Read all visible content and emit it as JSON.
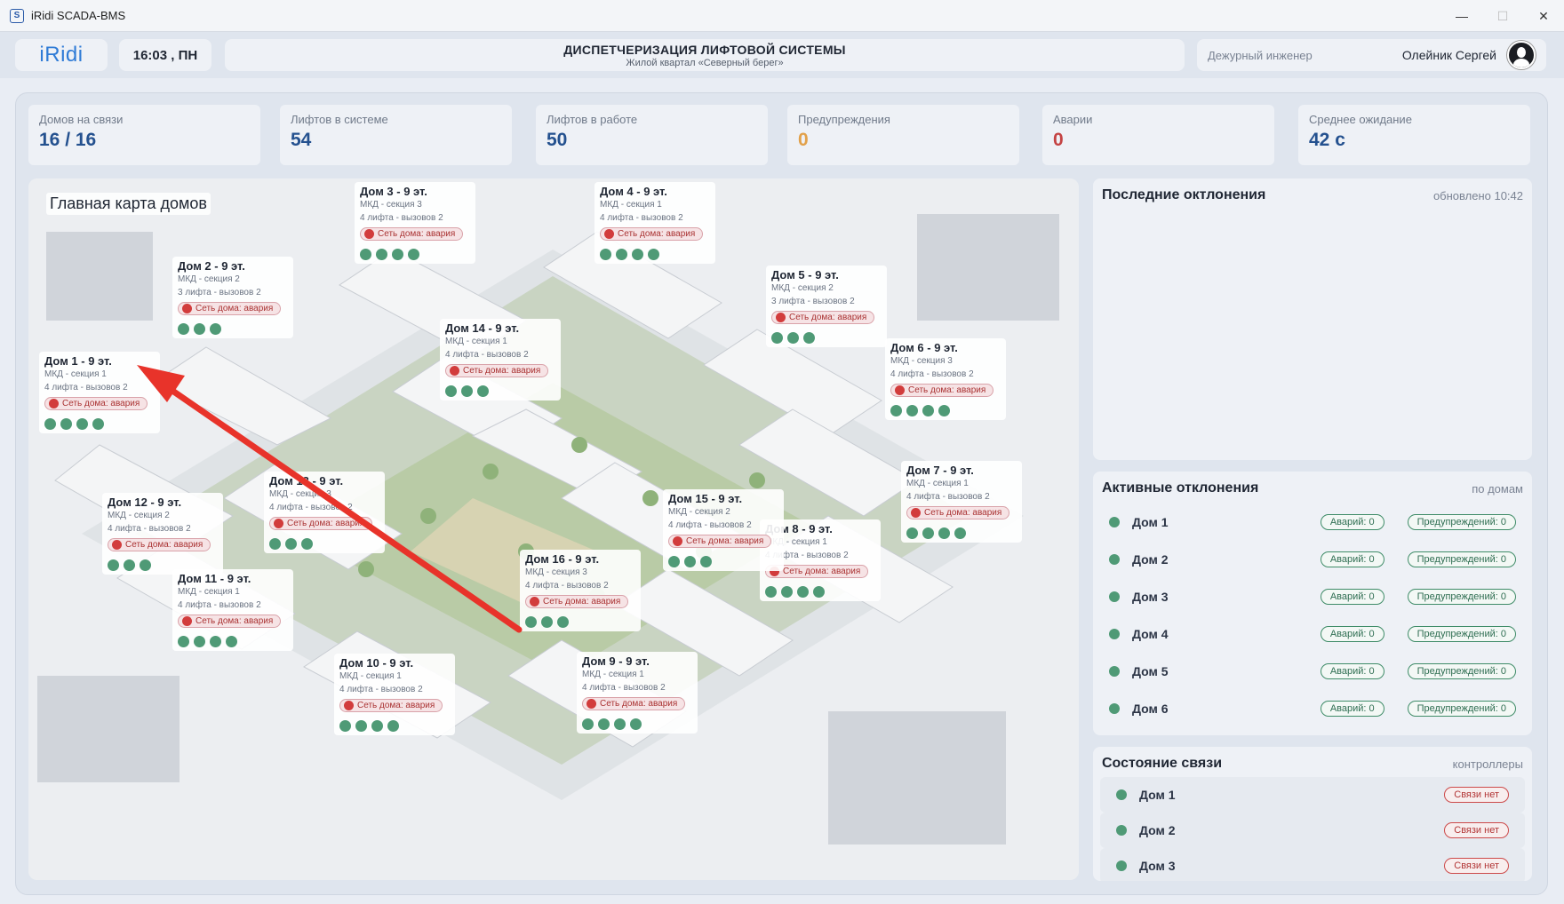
{
  "window": {
    "app_icon": "S",
    "title": "iRidi SCADA-BMS",
    "minimize": "—",
    "maximize": "☐",
    "close": "✕"
  },
  "header": {
    "logo": "iRidi",
    "time": "16:03 , ПН",
    "title": "ДИСПЕТЧЕРИЗАЦИЯ ЛИФТОВОЙ СИСТЕМЫ",
    "subtitle": "Жилой квартал «Северный берег»",
    "role": "Дежурный инженер",
    "user": "Олейник Сергей"
  },
  "kpis": [
    {
      "label": "Домов на связи",
      "value": "16 / 16"
    },
    {
      "label": "Лифтов в системе",
      "value": "54"
    },
    {
      "label": "Лифтов в работе",
      "value": "50"
    },
    {
      "label": "Предупреждения",
      "value": "0"
    },
    {
      "label": "Аварии",
      "value": "0"
    },
    {
      "label": "Среднее ожидание",
      "value": "42 с"
    }
  ],
  "map": {
    "title": "Главная карта домов",
    "houses": [
      {
        "title": "Дом 1 - 9 эт.",
        "section": "МКД - секция 1",
        "lifts": "4 лифта - вызовов 2",
        "alarm": "Сеть дома: авария",
        "dots": 4
      },
      {
        "title": "Дом 2 - 9 эт.",
        "section": "МКД - секция 2",
        "lifts": "3 лифта - вызовов 2",
        "alarm": "Сеть дома: авария",
        "dots": 3
      },
      {
        "title": "Дом 3 - 9 эт.",
        "section": "МКД - секция 3",
        "lifts": "4 лифта - вызовов 2",
        "alarm": "Сеть дома: авария",
        "dots": 4
      },
      {
        "title": "Дом 4 - 9 эт.",
        "section": "МКД - секция 1",
        "lifts": "4 лифта - вызовов 2",
        "alarm": "Сеть дома: авария",
        "dots": 4
      },
      {
        "title": "Дом 5 - 9 эт.",
        "section": "МКД - секция 2",
        "lifts": "3 лифта - вызовов 2",
        "alarm": "Сеть дома: авария",
        "dots": 3
      },
      {
        "title": "Дом 6 - 9 эт.",
        "section": "МКД - секция 3",
        "lifts": "4 лифта - вызовов 2",
        "alarm": "Сеть дома: авария",
        "dots": 4
      },
      {
        "title": "Дом 7 - 9 эт.",
        "section": "МКД - секция 1",
        "lifts": "4 лифта - вызовов 2",
        "alarm": "Сеть дома: авария",
        "dots": 4
      },
      {
        "title": "Дом 8 - 9 эт.",
        "section": "МКД - секция 1",
        "lifts": "4 лифта - вызовов 2",
        "alarm": "Сеть дома: авария",
        "dots": 4
      },
      {
        "title": "Дом 9 - 9 эт.",
        "section": "МКД - секция 1",
        "lifts": "4 лифта - вызовов 2",
        "alarm": "Сеть дома: авария",
        "dots": 4
      },
      {
        "title": "Дом 10 - 9 эт.",
        "section": "МКД - секция 1",
        "lifts": "4 лифта - вызовов 2",
        "alarm": "Сеть дома: авария",
        "dots": 4
      },
      {
        "title": "Дом 11 - 9 эт.",
        "section": "МКД - секция 1",
        "lifts": "4 лифта - вызовов 2",
        "alarm": "Сеть дома: авария",
        "dots": 4
      },
      {
        "title": "Дом 12 - 9 эт.",
        "section": "МКД - секция 2",
        "lifts": "4 лифта - вызовов 2",
        "alarm": "Сеть дома: авария",
        "dots": 3
      },
      {
        "title": "Дом 13 - 9 эт.",
        "section": "МКД - секция 3",
        "lifts": "4 лифта - вызовов 2",
        "alarm": "Сеть дома: авария",
        "dots": 3
      },
      {
        "title": "Дом 14 - 9 эт.",
        "section": "МКД - секция 1",
        "lifts": "4 лифта - вызовов 2",
        "alarm": "Сеть дома: авария",
        "dots": 3
      },
      {
        "title": "Дом 15 - 9 эт.",
        "section": "МКД - секция 2",
        "lifts": "4 лифта - вызовов 2",
        "alarm": "Сеть дома: авария",
        "dots": 3
      },
      {
        "title": "Дом 16 - 9 эт.",
        "section": "МКД - секция 3",
        "lifts": "4 лифта - вызовов 2",
        "alarm": "Сеть дома: авария",
        "dots": 3
      }
    ]
  },
  "recent": {
    "title": "Последние октлонения",
    "updated": "обновлено 10:42"
  },
  "active": {
    "title": "Активные отклонения",
    "subtitle": "по домам",
    "rows": [
      {
        "house": "Дом 1",
        "alarms": "Аварий: 0",
        "warnings": "Предупреждений: 0"
      },
      {
        "house": "Дом 2",
        "alarms": "Аварий: 0",
        "warnings": "Предупреждений: 0"
      },
      {
        "house": "Дом 3",
        "alarms": "Аварий: 0",
        "warnings": "Предупреждений: 0"
      },
      {
        "house": "Дом 4",
        "alarms": "Аварий: 0",
        "warnings": "Предупреждений: 0"
      },
      {
        "house": "Дом 5",
        "alarms": "Аварий: 0",
        "warnings": "Предупреждений: 0"
      },
      {
        "house": "Дом 6",
        "alarms": "Аварий: 0",
        "warnings": "Предупреждений: 0"
      }
    ]
  },
  "connection": {
    "title": "Состояние связи",
    "subtitle": "контроллеры",
    "rows": [
      {
        "house": "Дом 1",
        "status": "Связи нет"
      },
      {
        "house": "Дом 2",
        "status": "Связи нет"
      },
      {
        "house": "Дом 3",
        "status": "Связи нет"
      }
    ]
  },
  "colors": {
    "accent": "#2f7bd6",
    "ok": "#4f9a76",
    "alarm": "#d23c3c",
    "warning": "#e2a14a",
    "arrow": "#e8332a"
  }
}
